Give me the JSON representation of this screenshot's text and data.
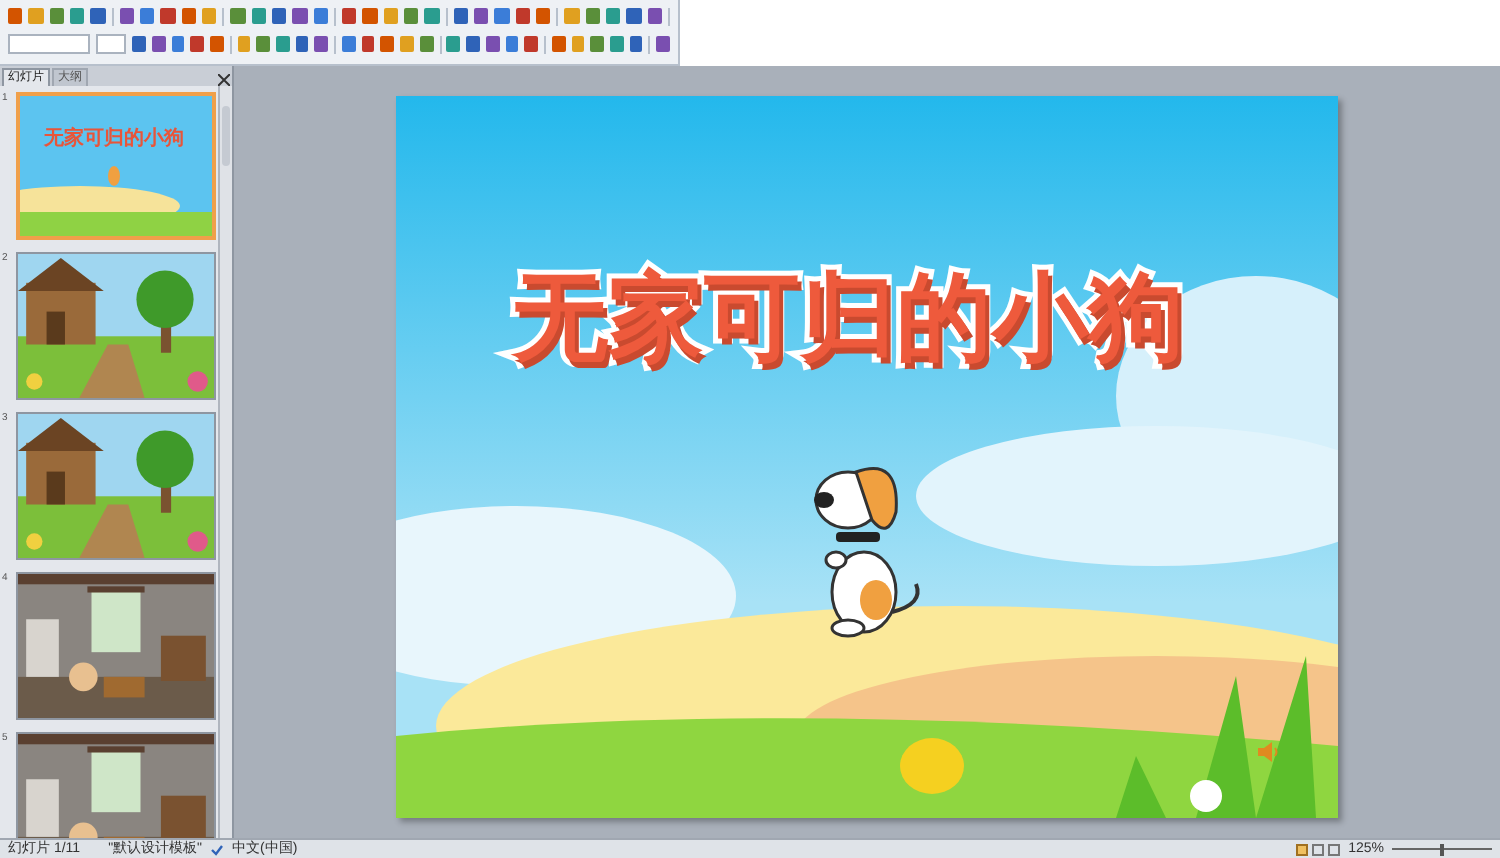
{
  "panel_tabs": [
    {
      "label": "幻灯片",
      "selected": true
    },
    {
      "label": "大纲",
      "selected": false
    }
  ],
  "slides": [
    {
      "number": "1",
      "selected": true,
      "kind": "title",
      "title": "无家可归的小狗"
    },
    {
      "number": "2",
      "selected": false,
      "kind": "garden"
    },
    {
      "number": "3",
      "selected": false,
      "kind": "garden"
    },
    {
      "number": "4",
      "selected": false,
      "kind": "room"
    },
    {
      "number": "5",
      "selected": false,
      "kind": "room"
    }
  ],
  "slide": {
    "title": "无家可归的小狗"
  },
  "status_bar": {
    "slide_count": "幻灯片 1/11",
    "theme": "\"默认设计模板\"",
    "language": "中文(中国)",
    "zoom": "125%",
    "zoom_slider": {
      "level": 0.5
    }
  }
}
